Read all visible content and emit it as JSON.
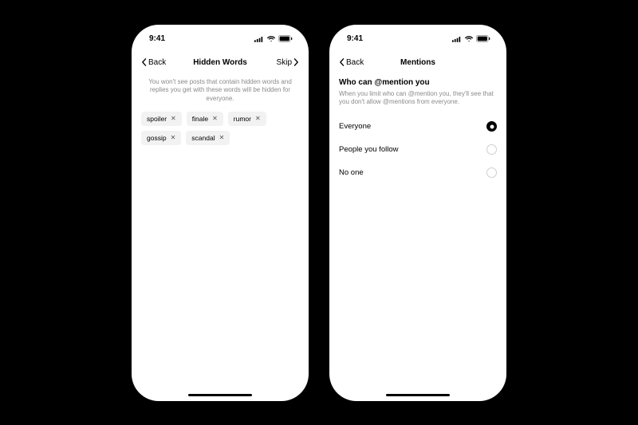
{
  "status": {
    "time": "9:41"
  },
  "left": {
    "back": "Back",
    "title": "Hidden Words",
    "skip": "Skip",
    "intro": "You won't see posts that contain hidden words and replies you get with these words will be hidden for everyone.",
    "chips": [
      "spoiler",
      "finale",
      "rumor",
      "gossip",
      "scandal"
    ]
  },
  "right": {
    "back": "Back",
    "title": "Mentions",
    "section_title": "Who can @mention you",
    "section_sub": "When you limit who can @mention you, they'll see that you don't allow @mentions from everyone.",
    "options": [
      {
        "label": "Everyone",
        "selected": true
      },
      {
        "label": "People you follow",
        "selected": false
      },
      {
        "label": "No one",
        "selected": false
      }
    ]
  }
}
